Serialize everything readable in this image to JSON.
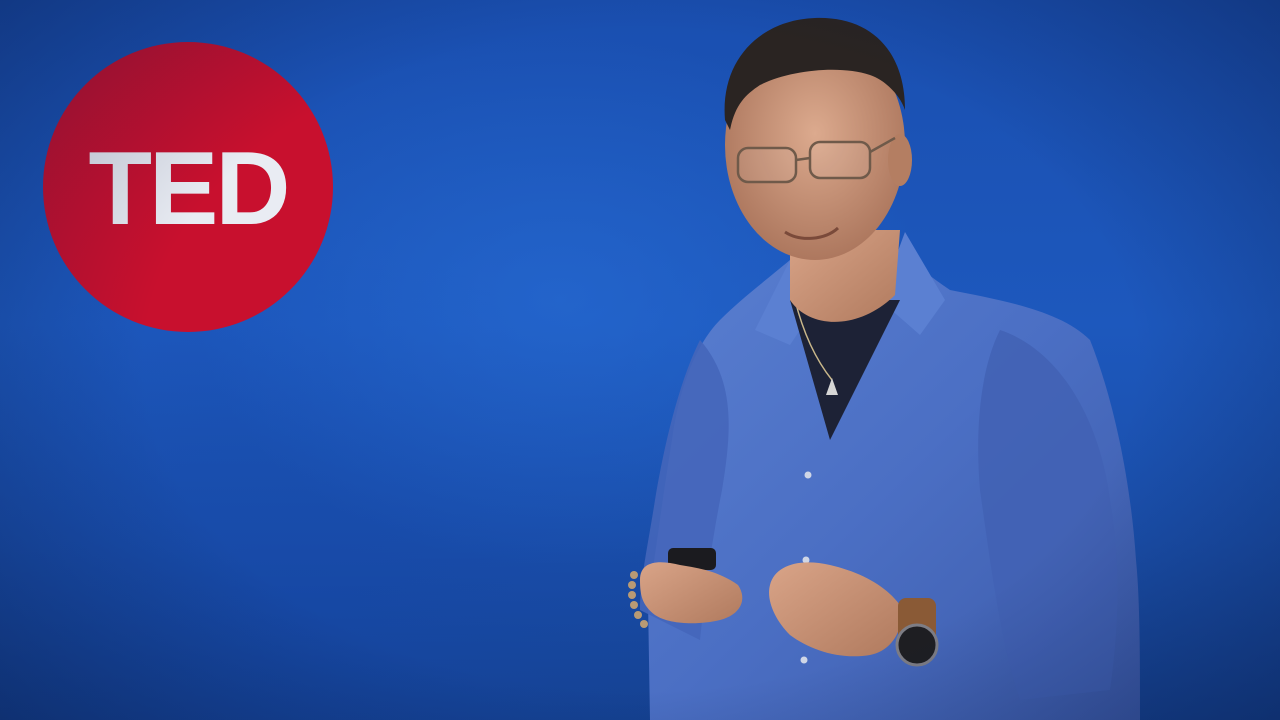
{
  "logo": {
    "text": "TED",
    "color": "#c8102e",
    "text_color": "#e9ecf3"
  },
  "scene": {
    "background_color": "#1d58bd",
    "subject": "speaker-on-stage"
  }
}
